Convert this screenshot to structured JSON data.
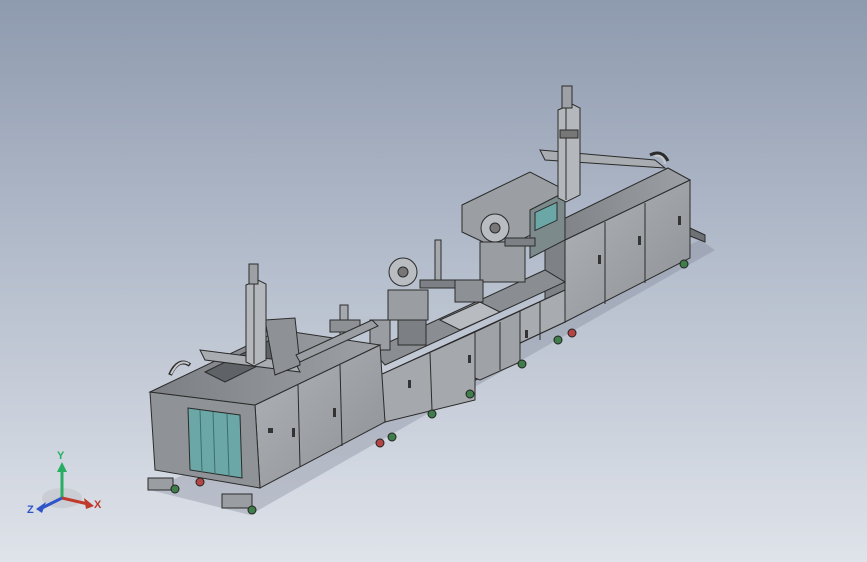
{
  "viewport": {
    "background_top": "#8e9aae",
    "background_bottom": "#dfe3ea"
  },
  "model": {
    "frame_color": "#8f9296",
    "panel_color": "#a2a5a9",
    "edge_color": "#2b2b2b",
    "guard_color": "#6aa7a6",
    "wheel_color": "#3f7d4b",
    "accent_red": "#b44545"
  },
  "triad": {
    "x_label": "X",
    "y_label": "Y",
    "z_label": "Z",
    "x_color": "#c0392b",
    "y_color": "#27ae60",
    "z_color": "#2f55c8"
  }
}
